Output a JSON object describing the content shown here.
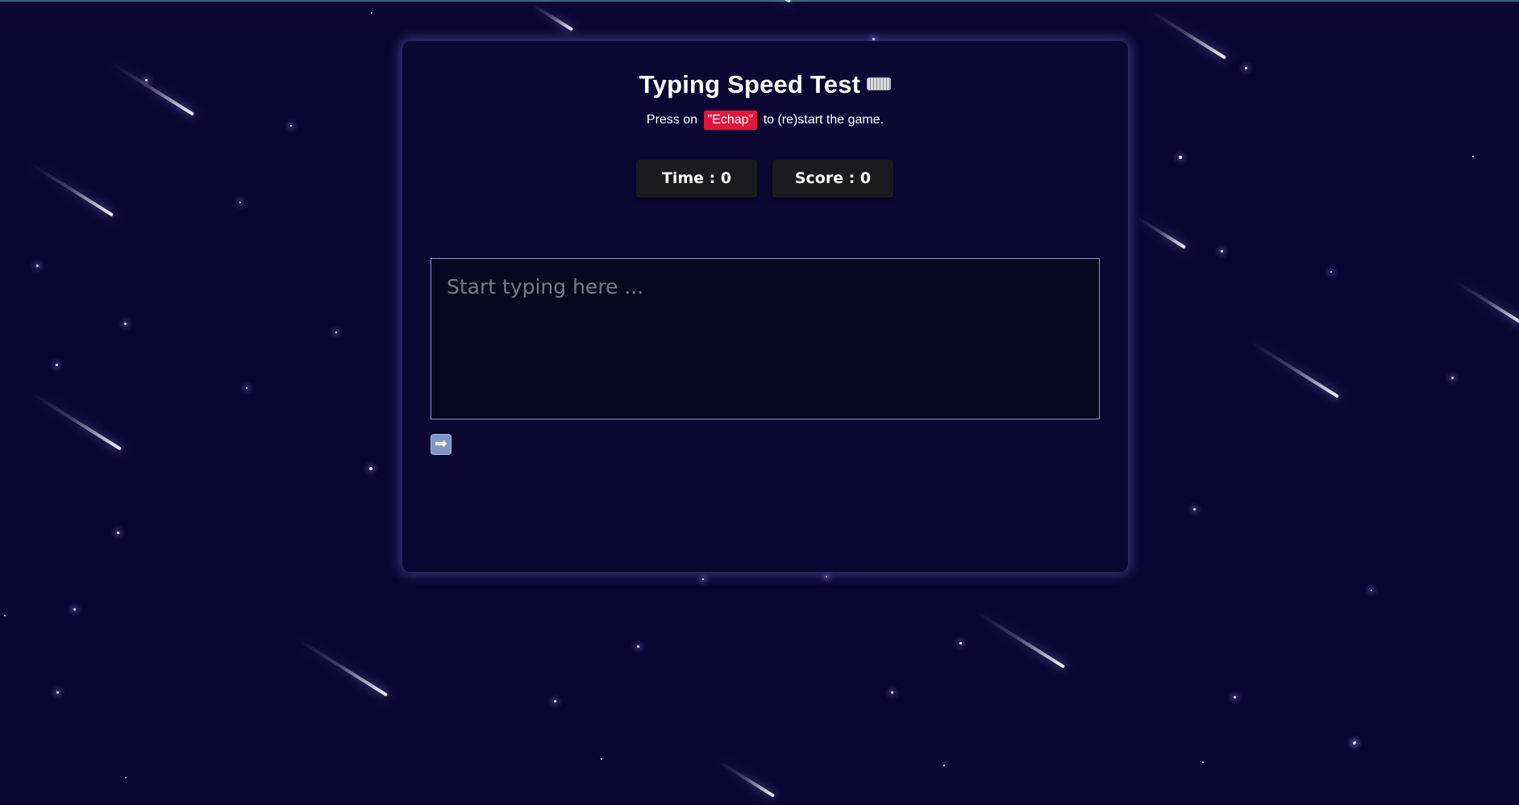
{
  "page": {
    "title": "Typing Speed Test",
    "title_icon": "keyboard-icon",
    "subtitle_before": "Press on",
    "subtitle_key": "\"Echap\"",
    "subtitle_after": "to (re)start the game."
  },
  "stats": {
    "time_label": "Time : 0",
    "score_label": "Score : 0"
  },
  "input": {
    "placeholder": "Start typing here ...",
    "value": ""
  },
  "controls": {
    "next_icon": "arrow-right-icon",
    "next_glyph": "➡"
  },
  "colors": {
    "background": "#0b0533",
    "panel": "#0c0632",
    "key_highlight": "#e0163a",
    "stat_box": "#1b1b1f",
    "input_border": "#8f8fd6",
    "next_button": "#7d96c6"
  }
}
